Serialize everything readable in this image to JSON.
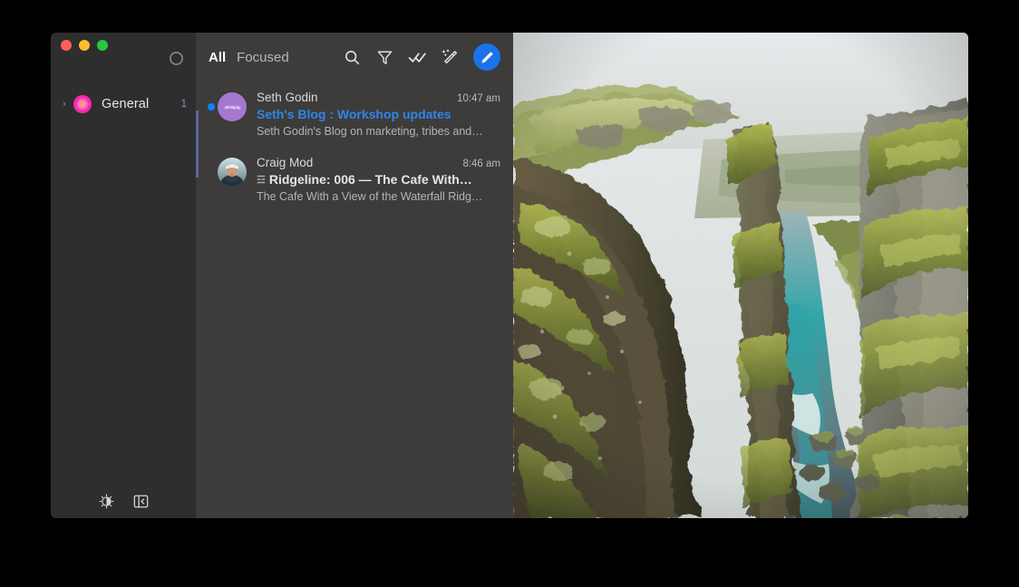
{
  "window": {
    "traffic_lights": [
      {
        "name": "close",
        "color": "#ff5f57"
      },
      {
        "name": "minimize",
        "color": "#febc2e"
      },
      {
        "name": "maximize",
        "color": "#28c840"
      }
    ]
  },
  "sidebar": {
    "sync_icon": "sync-refresh-icon",
    "folders": [
      {
        "disclosure": "›",
        "avatar_icon": "account-avatar-icon",
        "label": "General",
        "count": "1"
      }
    ],
    "footer_buttons": [
      {
        "icon": "appearance-theme-icon",
        "label": "Appearance"
      },
      {
        "icon": "toggle-sidebar-icon",
        "label": "Toggle Sidebar"
      }
    ]
  },
  "message_list": {
    "tabs": [
      {
        "label": "All",
        "active": true
      },
      {
        "label": "Focused",
        "active": false
      }
    ],
    "actions": [
      {
        "icon": "search-icon",
        "label": "Search"
      },
      {
        "icon": "filter-icon",
        "label": "Filter"
      },
      {
        "icon": "mark-all-read-icon",
        "label": "Mark all as read"
      },
      {
        "icon": "magic-wand-icon",
        "label": "Smart actions"
      }
    ],
    "compose": {
      "icon": "compose-pencil-icon",
      "label": "Compose",
      "color": "#1a73e8"
    },
    "messages": [
      {
        "sender": "Seth Godin",
        "time": "10:47 am",
        "subject": "Seth's Blog : Workshop updates",
        "subject_glyph": "",
        "preview": "Seth Godin's Blog on marketing, tribes and…",
        "unread": true,
        "selected": true,
        "avatar_type": "initials",
        "avatar_text": "altrktkjtpljg",
        "avatar_color": "#a578cf",
        "subject_color": "#2f86e8"
      },
      {
        "sender": "Craig Mod",
        "time": "8:46 am",
        "subject": "Ridgeline: 006 — The Cafe With…",
        "subject_glyph": "☲",
        "preview": "The Cafe With a View of the Waterfall Ridg…",
        "unread": false,
        "selected": false,
        "avatar_type": "photo",
        "avatar_text": "",
        "avatar_color": "#6c7c86",
        "subject_color": "#e6e6e6"
      }
    ]
  },
  "reading_pane": {
    "image_name": "canyon-landscape-photo",
    "alt": "Mossy canyon gorge with turquoise river under a pale sky"
  }
}
